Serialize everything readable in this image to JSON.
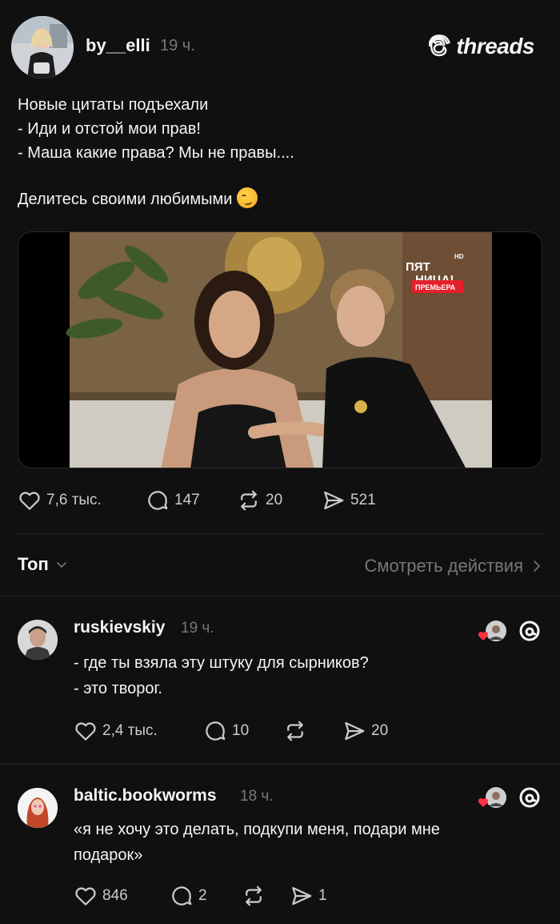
{
  "post": {
    "author": "by__elli",
    "time": "19 ч.",
    "brand": "threads",
    "text_lines": [
      "Новые цитаты подъехали",
      "- Иди и отстой мои прав!",
      "- Маша какие права? Мы не правы....",
      "Делитесь своими любимыми"
    ],
    "video_logo": [
      "ПЯТ",
      "НИЦА!"
    ],
    "video_badge": "ПРЕМЬЕРА",
    "video_hd": "HD",
    "stats": {
      "likes": "7,6 тыс.",
      "comments": "147",
      "reposts": "20",
      "shares": "521"
    }
  },
  "sort": {
    "label": "Топ",
    "activity_link": "Смотреть действия"
  },
  "replies": [
    {
      "author": "ruskievskiy",
      "time": "19 ч.",
      "text_lines": [
        "- где ты взяла эту штуку для сырников?",
        "- это творог."
      ],
      "stats": {
        "likes": "2,4 тыс.",
        "comments": "10",
        "reposts": "",
        "shares": "20"
      }
    },
    {
      "author": "baltic.bookworms",
      "time": "18 ч.",
      "text_lines": [
        "«я не хочу это делать, подкупи меня, подари мне",
        "подарок»"
      ],
      "stats": {
        "likes": "846",
        "comments": "2",
        "reposts": "",
        "shares": "1"
      }
    }
  ],
  "colors": {
    "background": "#101010",
    "text": "#f3f5f7",
    "muted": "#777777",
    "heart": "#ff3040"
  }
}
